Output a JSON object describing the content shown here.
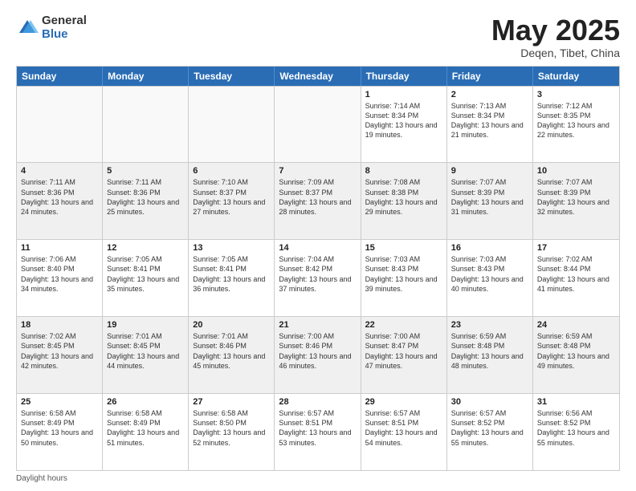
{
  "logo": {
    "general": "General",
    "blue": "Blue"
  },
  "title": {
    "month_year": "May 2025",
    "location": "Deqen, Tibet, China"
  },
  "header_days": [
    "Sunday",
    "Monday",
    "Tuesday",
    "Wednesday",
    "Thursday",
    "Friday",
    "Saturday"
  ],
  "weeks": [
    [
      {
        "day": "",
        "empty": true
      },
      {
        "day": "",
        "empty": true
      },
      {
        "day": "",
        "empty": true
      },
      {
        "day": "",
        "empty": true
      },
      {
        "day": "1",
        "sunrise": "Sunrise: 7:14 AM",
        "sunset": "Sunset: 8:34 PM",
        "daylight": "Daylight: 13 hours and 19 minutes."
      },
      {
        "day": "2",
        "sunrise": "Sunrise: 7:13 AM",
        "sunset": "Sunset: 8:34 PM",
        "daylight": "Daylight: 13 hours and 21 minutes."
      },
      {
        "day": "3",
        "sunrise": "Sunrise: 7:12 AM",
        "sunset": "Sunset: 8:35 PM",
        "daylight": "Daylight: 13 hours and 22 minutes."
      }
    ],
    [
      {
        "day": "4",
        "sunrise": "Sunrise: 7:11 AM",
        "sunset": "Sunset: 8:36 PM",
        "daylight": "Daylight: 13 hours and 24 minutes."
      },
      {
        "day": "5",
        "sunrise": "Sunrise: 7:11 AM",
        "sunset": "Sunset: 8:36 PM",
        "daylight": "Daylight: 13 hours and 25 minutes."
      },
      {
        "day": "6",
        "sunrise": "Sunrise: 7:10 AM",
        "sunset": "Sunset: 8:37 PM",
        "daylight": "Daylight: 13 hours and 27 minutes."
      },
      {
        "day": "7",
        "sunrise": "Sunrise: 7:09 AM",
        "sunset": "Sunset: 8:37 PM",
        "daylight": "Daylight: 13 hours and 28 minutes."
      },
      {
        "day": "8",
        "sunrise": "Sunrise: 7:08 AM",
        "sunset": "Sunset: 8:38 PM",
        "daylight": "Daylight: 13 hours and 29 minutes."
      },
      {
        "day": "9",
        "sunrise": "Sunrise: 7:07 AM",
        "sunset": "Sunset: 8:39 PM",
        "daylight": "Daylight: 13 hours and 31 minutes."
      },
      {
        "day": "10",
        "sunrise": "Sunrise: 7:07 AM",
        "sunset": "Sunset: 8:39 PM",
        "daylight": "Daylight: 13 hours and 32 minutes."
      }
    ],
    [
      {
        "day": "11",
        "sunrise": "Sunrise: 7:06 AM",
        "sunset": "Sunset: 8:40 PM",
        "daylight": "Daylight: 13 hours and 34 minutes."
      },
      {
        "day": "12",
        "sunrise": "Sunrise: 7:05 AM",
        "sunset": "Sunset: 8:41 PM",
        "daylight": "Daylight: 13 hours and 35 minutes."
      },
      {
        "day": "13",
        "sunrise": "Sunrise: 7:05 AM",
        "sunset": "Sunset: 8:41 PM",
        "daylight": "Daylight: 13 hours and 36 minutes."
      },
      {
        "day": "14",
        "sunrise": "Sunrise: 7:04 AM",
        "sunset": "Sunset: 8:42 PM",
        "daylight": "Daylight: 13 hours and 37 minutes."
      },
      {
        "day": "15",
        "sunrise": "Sunrise: 7:03 AM",
        "sunset": "Sunset: 8:43 PM",
        "daylight": "Daylight: 13 hours and 39 minutes."
      },
      {
        "day": "16",
        "sunrise": "Sunrise: 7:03 AM",
        "sunset": "Sunset: 8:43 PM",
        "daylight": "Daylight: 13 hours and 40 minutes."
      },
      {
        "day": "17",
        "sunrise": "Sunrise: 7:02 AM",
        "sunset": "Sunset: 8:44 PM",
        "daylight": "Daylight: 13 hours and 41 minutes."
      }
    ],
    [
      {
        "day": "18",
        "sunrise": "Sunrise: 7:02 AM",
        "sunset": "Sunset: 8:45 PM",
        "daylight": "Daylight: 13 hours and 42 minutes."
      },
      {
        "day": "19",
        "sunrise": "Sunrise: 7:01 AM",
        "sunset": "Sunset: 8:45 PM",
        "daylight": "Daylight: 13 hours and 44 minutes."
      },
      {
        "day": "20",
        "sunrise": "Sunrise: 7:01 AM",
        "sunset": "Sunset: 8:46 PM",
        "daylight": "Daylight: 13 hours and 45 minutes."
      },
      {
        "day": "21",
        "sunrise": "Sunrise: 7:00 AM",
        "sunset": "Sunset: 8:46 PM",
        "daylight": "Daylight: 13 hours and 46 minutes."
      },
      {
        "day": "22",
        "sunrise": "Sunrise: 7:00 AM",
        "sunset": "Sunset: 8:47 PM",
        "daylight": "Daylight: 13 hours and 47 minutes."
      },
      {
        "day": "23",
        "sunrise": "Sunrise: 6:59 AM",
        "sunset": "Sunset: 8:48 PM",
        "daylight": "Daylight: 13 hours and 48 minutes."
      },
      {
        "day": "24",
        "sunrise": "Sunrise: 6:59 AM",
        "sunset": "Sunset: 8:48 PM",
        "daylight": "Daylight: 13 hours and 49 minutes."
      }
    ],
    [
      {
        "day": "25",
        "sunrise": "Sunrise: 6:58 AM",
        "sunset": "Sunset: 8:49 PM",
        "daylight": "Daylight: 13 hours and 50 minutes."
      },
      {
        "day": "26",
        "sunrise": "Sunrise: 6:58 AM",
        "sunset": "Sunset: 8:49 PM",
        "daylight": "Daylight: 13 hours and 51 minutes."
      },
      {
        "day": "27",
        "sunrise": "Sunrise: 6:58 AM",
        "sunset": "Sunset: 8:50 PM",
        "daylight": "Daylight: 13 hours and 52 minutes."
      },
      {
        "day": "28",
        "sunrise": "Sunrise: 6:57 AM",
        "sunset": "Sunset: 8:51 PM",
        "daylight": "Daylight: 13 hours and 53 minutes."
      },
      {
        "day": "29",
        "sunrise": "Sunrise: 6:57 AM",
        "sunset": "Sunset: 8:51 PM",
        "daylight": "Daylight: 13 hours and 54 minutes."
      },
      {
        "day": "30",
        "sunrise": "Sunrise: 6:57 AM",
        "sunset": "Sunset: 8:52 PM",
        "daylight": "Daylight: 13 hours and 55 minutes."
      },
      {
        "day": "31",
        "sunrise": "Sunrise: 6:56 AM",
        "sunset": "Sunset: 8:52 PM",
        "daylight": "Daylight: 13 hours and 55 minutes."
      }
    ]
  ],
  "footer": {
    "note": "Daylight hours"
  }
}
